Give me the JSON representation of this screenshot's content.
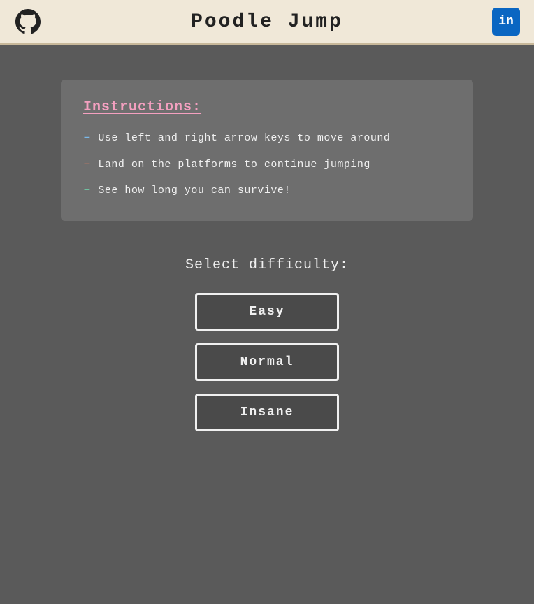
{
  "header": {
    "title": "Poodle  Jump",
    "github_label": "GitHub",
    "linkedin_label": "in"
  },
  "instructions": {
    "heading": "Instructions:",
    "items": [
      {
        "bullet": "–",
        "text": "Use left and right arrow keys to move around",
        "bullet_class": "bullet-blue"
      },
      {
        "bullet": "–",
        "text": "Land on the platforms to continue jumping",
        "bullet_class": "bullet-orange"
      },
      {
        "bullet": "–",
        "text": "See how long you can survive!",
        "bullet_class": "bullet-teal"
      }
    ]
  },
  "difficulty": {
    "label": "Select difficulty:",
    "buttons": [
      {
        "label": "Easy"
      },
      {
        "label": "Normal"
      },
      {
        "label": "Insane"
      }
    ]
  }
}
